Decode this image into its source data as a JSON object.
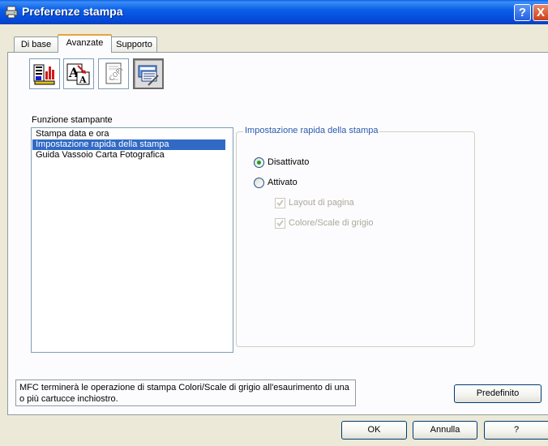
{
  "window": {
    "title": "Preferenze stampa",
    "help_label": "?",
    "close_label": "X"
  },
  "tabs": [
    {
      "label": "Di base",
      "active": false
    },
    {
      "label": "Avanzate",
      "active": true
    },
    {
      "label": "Supporto",
      "active": false
    }
  ],
  "toolbar": [
    {
      "icon": "print-quality-icon",
      "active": false
    },
    {
      "icon": "font-scaling-icon",
      "active": false
    },
    {
      "icon": "watermark-copy-icon",
      "active": false
    },
    {
      "icon": "device-options-icon",
      "active": true
    }
  ],
  "function_list": {
    "label": "Funzione stampante",
    "items": [
      {
        "label": "Stampa data e ora",
        "selected": false
      },
      {
        "label": "Impostazione rapida della stampa",
        "selected": true
      },
      {
        "label": "Guida Vassoio Carta Fotografica",
        "selected": false
      }
    ]
  },
  "quick_setup": {
    "title": "Impostazione rapida della stampa",
    "radio_off": "Disattivato",
    "radio_on": "Attivato",
    "selected": "Disattivato",
    "check_layout": "Layout di pagina",
    "check_color": "Colore/Scale di grigio",
    "checks_enabled": false
  },
  "status_message": "MFC terminerà le operazione di stampa Colori/Scale di grigio all'esaurimento di una o più cartucce inchiostro.",
  "buttons": {
    "default": "Predefinito",
    "ok": "OK",
    "cancel": "Annulla",
    "help": "?"
  },
  "colors": {
    "accent_tab": "#e6a33b",
    "selection": "#316ac5",
    "group_title": "#2a5ab0"
  }
}
